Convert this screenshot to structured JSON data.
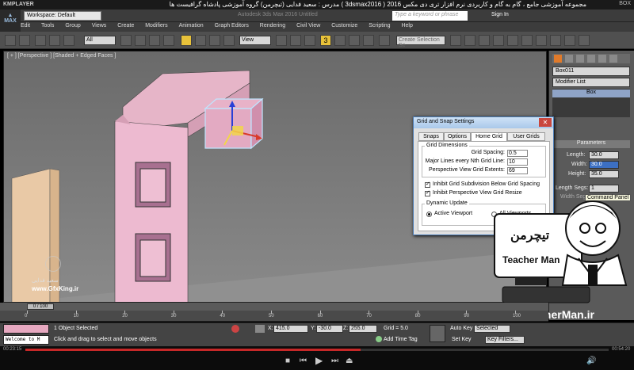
{
  "player": {
    "name": "KMPLAYER",
    "title": "مجموعه آموزشی جامع ، گام به گام و کاربردی نرم افزار تری دی مکس 2016 ( 3dsmax2016 )  مدرس : سعید فدایی (تیچرمن) گروه آموزشی پادشاه گرافیست ها",
    "right_label": "BOX ",
    "time_elapsed": "00:23:15",
    "time_total": "00:54:20",
    "progress_percent": 0.575
  },
  "app": {
    "logo": "MAX",
    "workspace": "Workspace: Default",
    "title": "Autodesk 3ds Max 2016      Untitled",
    "search_placeholder": "Type a keyword or phrase",
    "sign_in": "Sign In",
    "menus": [
      "Edit",
      "Tools",
      "Group",
      "Views",
      "Create",
      "Modifiers",
      "Animation",
      "Graph Editors",
      "Rendering",
      "Civil View",
      "Customize",
      "Scripting",
      "Help"
    ]
  },
  "toolbar": {
    "selection_filter": "All",
    "ref_coord": "View",
    "snap_toggle": "3",
    "named_selection": "Create Selection Se"
  },
  "viewport": {
    "label": "[ + ] [Perspective ] [Shaded + Edged Faces ]"
  },
  "command_panel": {
    "object_name": "Box011",
    "modifier_list": "Modifier List",
    "stack_item": "Box",
    "parameters_title": "Parameters",
    "length_label": "Length:",
    "length_value": "30.0",
    "width_label": "Width:",
    "width_value": "30.0",
    "height_label": "Height:",
    "height_value": "35.0",
    "length_segs_label": "Length Segs:",
    "length_segs_value": "1",
    "width_segs_label": "Width Segs:",
    "tooltip": "Command Panel"
  },
  "dialog": {
    "title": "Grid and Snap Settings",
    "close": "✕",
    "tabs": [
      "Snaps",
      "Options",
      "Home Grid",
      "User Grids"
    ],
    "group_dimensions": "Grid Dimensions",
    "grid_spacing_label": "Grid Spacing:",
    "grid_spacing_value": "0.5",
    "major_lines_label": "Major Lines every Nth Grid Line:",
    "major_lines_value": "10",
    "perspective_extents_label": "Perspective View Grid Extents:",
    "perspective_extents_value": "69",
    "inhibit_subdivision": "Inhibit Grid Subdivision Below Grid Spacing",
    "inhibit_perspective": "Inhibit Perspective View Grid Resize",
    "group_dynamic": "Dynamic Update",
    "active_viewport": "Active Viewport",
    "all_viewports": "All Viewports"
  },
  "timeline": {
    "slider": "0 / 100",
    "ticks": [
      "0",
      "10",
      "20",
      "30",
      "40",
      "50",
      "60",
      "70",
      "80",
      "90",
      "100"
    ]
  },
  "status": {
    "listener": "Welcome to M",
    "selected": "1 Object Selected",
    "prompt": "Click and drag to select and move objects",
    "x_label": "X:",
    "x_value": "415.0",
    "y_label": "Y:",
    "y_value": "-30.0",
    "z_label": "Z:",
    "z_value": "255.0",
    "grid": "Grid = 5.0",
    "auto_key": "Auto Key",
    "set_key": "Set Key",
    "selected_dd": "Selected",
    "key_filters": "Key Filters...",
    "add_time_tag": "Add Time Tag"
  },
  "watermark": {
    "name": "سعید فدایی",
    "site": "www.GfxKing.ir",
    "teacher_fa": "تیچرمن",
    "teacher_en": "Teacher Man",
    "teacher_site": "www.TeacherMan.ir"
  }
}
